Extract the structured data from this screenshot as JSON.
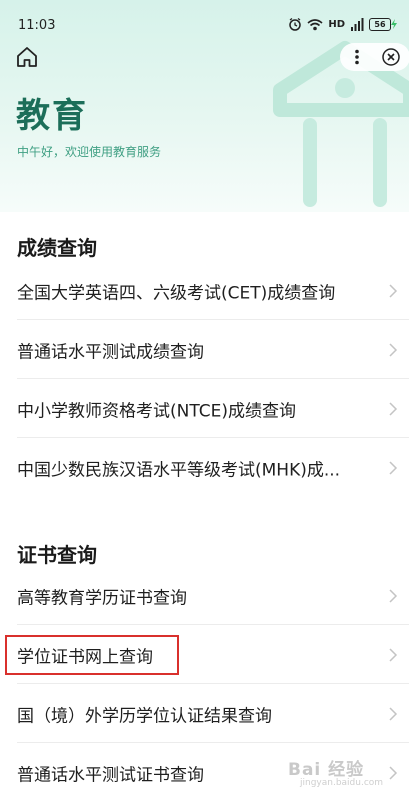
{
  "status_bar": {
    "time": "11:03",
    "network": "HD",
    "battery": "56"
  },
  "header": {
    "title": "教育",
    "subtitle": "中午好，欢迎使用教育服务"
  },
  "sections": [
    {
      "title": "成绩查询",
      "items": [
        "全国大学英语四、六级考试(CET)成绩查询",
        "普通话水平测试成绩查询",
        "中小学教师资格考试(NTCE)成绩查询",
        "中国少数民族汉语水平等级考试(MHK)成..."
      ]
    },
    {
      "title": "证书查询",
      "items": [
        "高等教育学历证书查询",
        "学位证书网上查询",
        "国（境）外学历学位认证结果查询",
        "普通话水平测试证书查询"
      ]
    }
  ],
  "watermark": {
    "text": "Bai 经验",
    "sub": "jingyan.baidu.com"
  },
  "colors": {
    "accent": "#1c6e59",
    "highlight": "#d9302c"
  }
}
